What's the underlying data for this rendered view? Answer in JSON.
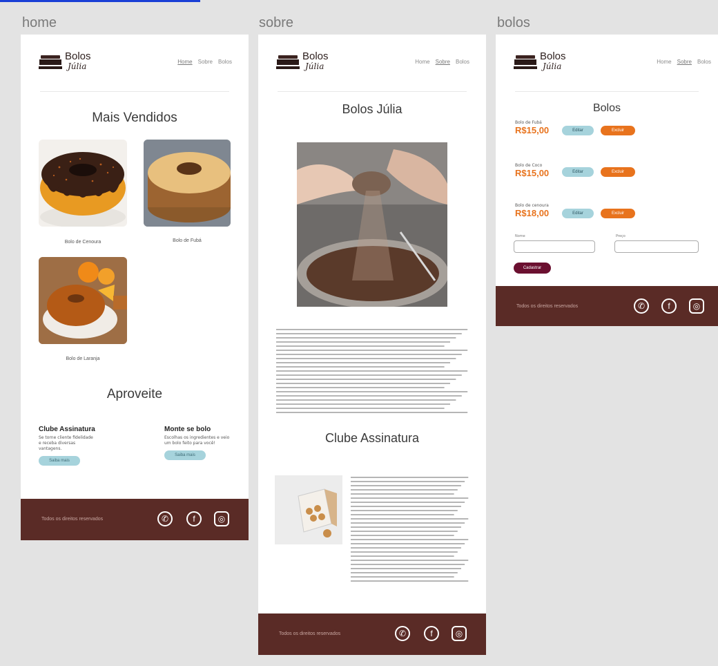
{
  "frames": {
    "home": "home",
    "sobre": "sobre",
    "bolos": "bolos"
  },
  "brand": {
    "line1": "Bolos",
    "line2": "Júlia"
  },
  "menu": [
    "Home",
    "Sobre",
    "Bolos"
  ],
  "home": {
    "heading": "Mais Vendidos",
    "products": [
      {
        "caption": "Bolo de Cenoura"
      },
      {
        "caption": "Bolo de Fubá"
      },
      {
        "caption": "Bolo de Laranja"
      }
    ],
    "section2": "Aproveite",
    "club_title": "Clube Assinatura",
    "club_text": "Se torne cliente fidelidade e receba diversas vantagens.",
    "club_button": "Saiba mais",
    "build_title": "Monte se bolo",
    "build_text": "Escolhas os ingredientes e veio um bolo feito para você!",
    "build_button": "Saiba mais"
  },
  "sobre": {
    "title": "Bolos Júlia",
    "section2": "Clube Assinatura"
  },
  "bolos": {
    "title": "Bolos",
    "items": [
      {
        "name": "Bolo de Fubá",
        "price": "R$15,00",
        "edit": "Editar",
        "delete": "Excluir"
      },
      {
        "name": "Bolo de Coco",
        "price": "R$15,00",
        "edit": "Editar",
        "delete": "Excluir"
      },
      {
        "name": "Bolo de cenoura",
        "price": "R$18,00",
        "edit": "Editar",
        "delete": "Excluir"
      }
    ],
    "field_name_label": "Nome",
    "field_price_label": "Preço",
    "submit": "Cadastrar"
  },
  "footer": {
    "text": "Todos os direitos reservados"
  },
  "colors": {
    "footer": "#5a2b26",
    "edit": "#a6d3dc",
    "delete": "#e8731d",
    "submit": "#6b1030"
  }
}
